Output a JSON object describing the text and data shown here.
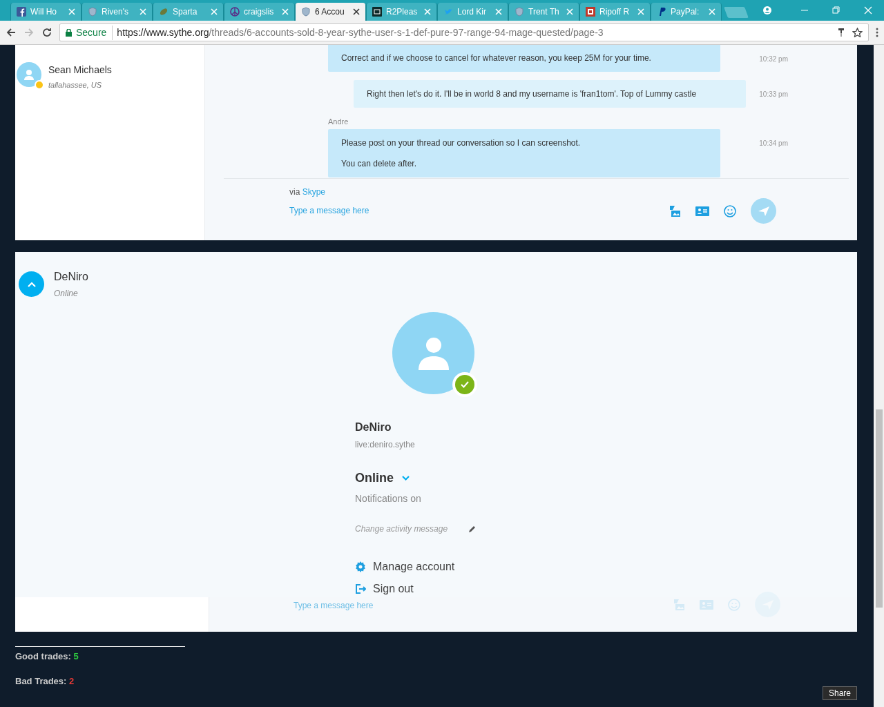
{
  "browser": {
    "tabs": [
      {
        "title": "Will Ho",
        "selected": false,
        "kind": "facebook"
      },
      {
        "title": "Riven's",
        "selected": false,
        "kind": "shield"
      },
      {
        "title": "Sparta",
        "selected": false,
        "kind": "leaf"
      },
      {
        "title": "craigslis",
        "selected": false,
        "kind": "peace"
      },
      {
        "title": "6 Accou",
        "selected": true,
        "kind": "shield"
      },
      {
        "title": "R2Pleas",
        "selected": false,
        "kind": "r2"
      },
      {
        "title": "Lord Kir",
        "selected": false,
        "kind": "bird"
      },
      {
        "title": "Trent Th",
        "selected": false,
        "kind": "shield"
      },
      {
        "title": "Ripoff R",
        "selected": false,
        "kind": "ripoff"
      },
      {
        "title": "PayPal:",
        "selected": false,
        "kind": "paypal"
      }
    ],
    "secure_label": "Secure",
    "url_host": "https://www.sythe.org",
    "url_path": "/threads/6-accounts-sold-8-year-sythe-user-s-1-def-pure-97-range-94-mage-quested/page-3"
  },
  "contact": {
    "name": "Sean Michaels",
    "location": "tallahassee, US"
  },
  "messages": [
    {
      "kind": "incoming",
      "lines": [
        "Correct and if we choose to cancel for whatever reason, you keep 25M for your time."
      ],
      "time": "10:32 pm"
    },
    {
      "kind": "outgoing",
      "lines": [
        "Right then let's do it. I'll be in world 8  and my username is 'fran1tom'. Top of Lummy castle"
      ],
      "time": "10:33 pm"
    },
    {
      "kind": "incoming",
      "sender": "Andre",
      "lines": [
        "Please post on your thread our conversation so I can screenshot.",
        "You can delete after."
      ],
      "time": "10:34 pm"
    }
  ],
  "composer": {
    "via": "via",
    "via_link": "Skype",
    "placeholder": "Type a message here"
  },
  "profile_header": {
    "name": "DeNiro",
    "status": "Online"
  },
  "profile": {
    "name": "DeNiro",
    "skype_id": "live:deniro.sythe",
    "status": "Online",
    "notifications": "Notifications on",
    "activity_placeholder": "Change activity message",
    "menu": [
      {
        "kind": "manage",
        "label": "Manage account"
      },
      {
        "kind": "signout",
        "label": "Sign out"
      }
    ]
  },
  "faded_composer": {
    "placeholder": "Type a message here"
  },
  "trades": [
    {
      "label": "Good trades:",
      "value": "5",
      "kind": "good"
    },
    {
      "label": "Bad Trades:",
      "value": "2",
      "kind": "bad"
    }
  ],
  "share_button": "Share"
}
